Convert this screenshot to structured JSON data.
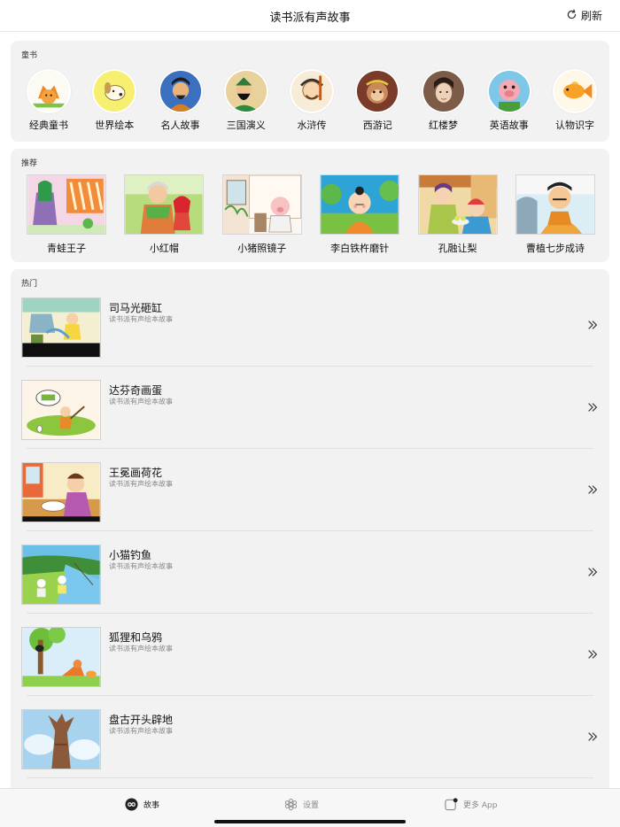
{
  "header": {
    "title": "读书派有声故事",
    "refresh_label": "刷新"
  },
  "categories": {
    "label": "童书",
    "items": [
      {
        "name": "经典童书",
        "icon": "fox-illustration"
      },
      {
        "name": "世界绘本",
        "icon": "dog-illustration"
      },
      {
        "name": "名人故事",
        "icon": "scholar-portrait"
      },
      {
        "name": "三国演义",
        "icon": "general-portrait"
      },
      {
        "name": "水浒传",
        "icon": "hero-portrait"
      },
      {
        "name": "西游记",
        "icon": "monkey-king-portrait"
      },
      {
        "name": "红楼梦",
        "icon": "lady-portrait"
      },
      {
        "name": "英语故事",
        "icon": "pig-cartoon"
      },
      {
        "name": "认物识字",
        "icon": "goldfish-illustration"
      }
    ]
  },
  "recommend": {
    "label": "推荐",
    "items": [
      {
        "name": "青蛙王子"
      },
      {
        "name": "小红帽"
      },
      {
        "name": "小猪照镜子"
      },
      {
        "name": "李白铁杵磨针"
      },
      {
        "name": "孔融让梨"
      },
      {
        "name": "曹植七步成诗"
      }
    ]
  },
  "hot": {
    "label": "热门",
    "items": [
      {
        "title": "司马光砸缸",
        "subtitle": "读书派有声绘本故事"
      },
      {
        "title": "达芬奇画蛋",
        "subtitle": "读书派有声绘本故事"
      },
      {
        "title": "王冕画荷花",
        "subtitle": "读书派有声绘本故事"
      },
      {
        "title": "小猫钓鱼",
        "subtitle": "读书派有声绘本故事"
      },
      {
        "title": "狐狸和乌鸦",
        "subtitle": "读书派有声绘本故事"
      },
      {
        "title": "盘古开头辟地",
        "subtitle": "读书派有声绘本故事"
      }
    ]
  },
  "tabbar": {
    "story_label": "故事",
    "settings_label": "设置",
    "more_label": "更多 App"
  }
}
